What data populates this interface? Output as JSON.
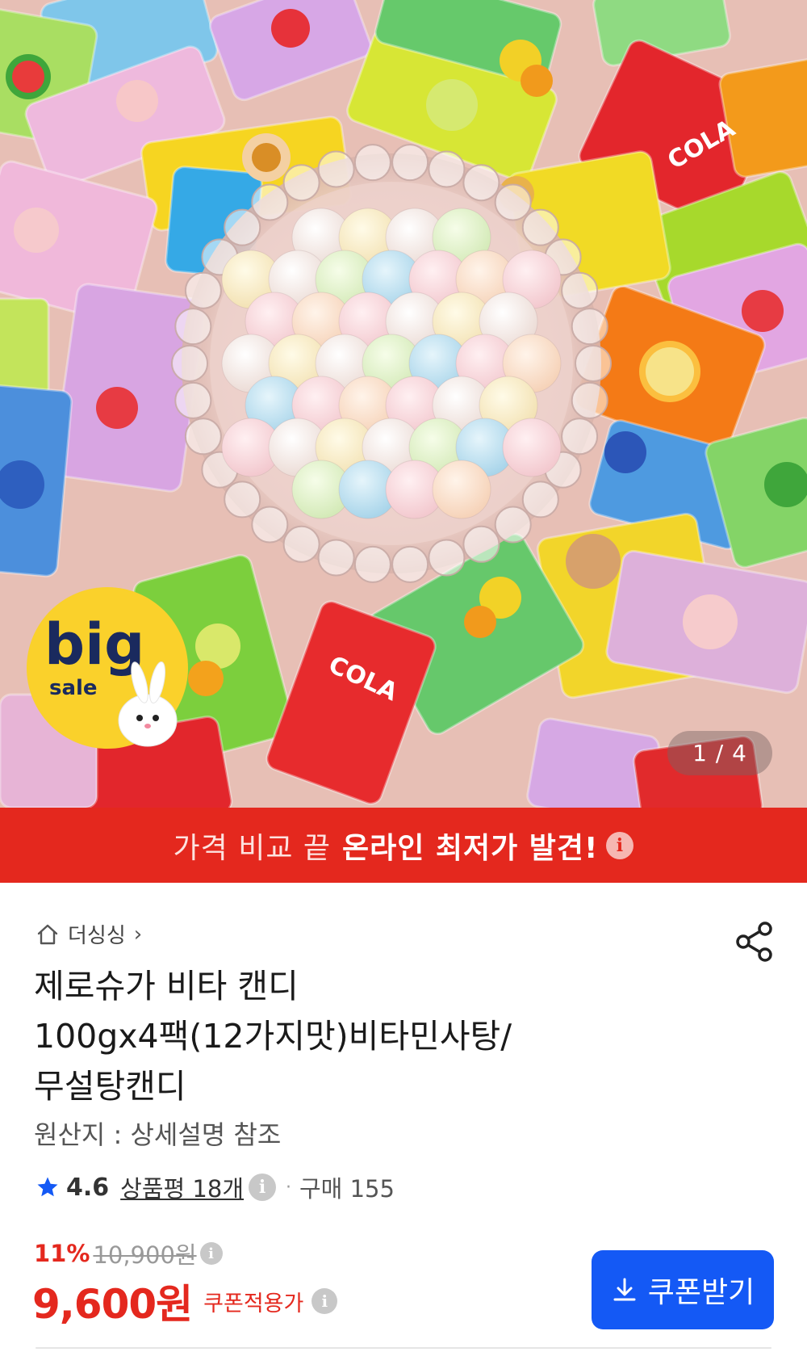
{
  "hero": {
    "counter": "1 / 4",
    "badge": {
      "big": "big",
      "sale": "sale"
    },
    "wrapper_labels": {
      "cola": "COLA"
    }
  },
  "banner": {
    "prefix": "가격 비교 끝",
    "highlight": "온라인 최저가 발견!",
    "info_icon": "info-icon"
  },
  "store": {
    "icon": "home-icon",
    "name": "더싱싱",
    "chevron": "›"
  },
  "product": {
    "title_lines": [
      "제로슈가 비타 캔디",
      "100gx4팩(12가지맛)비타민사탕/",
      "무설탕캔디"
    ],
    "origin": "원산지 : 상세설명 참조"
  },
  "rating": {
    "score": "4.6",
    "reviews": "상품평 18개",
    "separator": "·",
    "purchase": "구매 155"
  },
  "pricing": {
    "discount_pct": "11%",
    "original_price": "10,900원",
    "price": "9,600원",
    "coupon_label": "쿠폰적용가"
  },
  "coupon_button": {
    "label": "쿠폰받기",
    "icon": "download-icon"
  },
  "colors": {
    "accent_red": "#e4281e",
    "accent_blue": "#1459f5",
    "star": "#1459f5"
  }
}
